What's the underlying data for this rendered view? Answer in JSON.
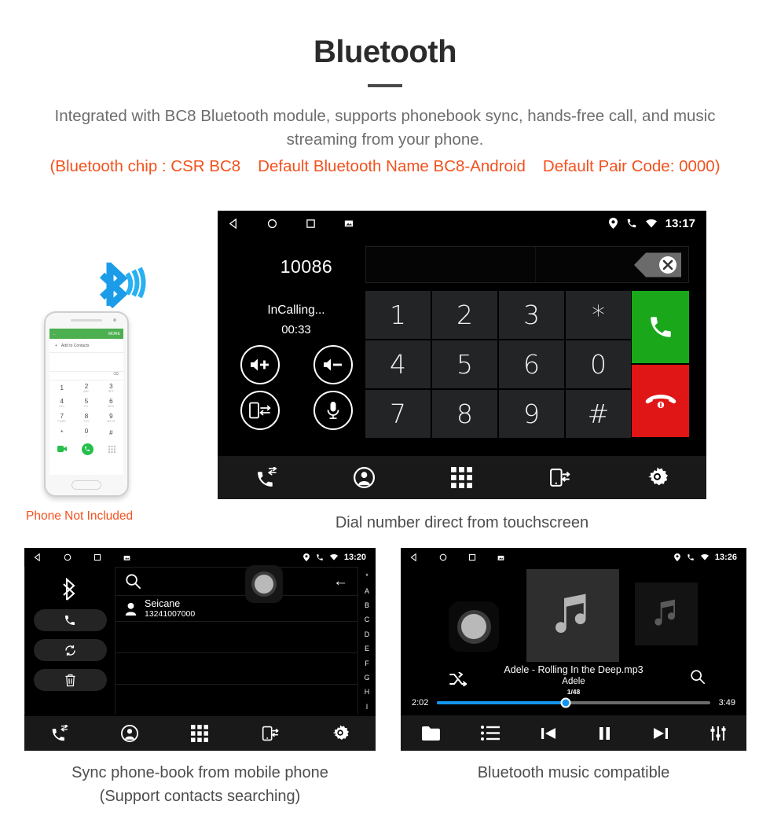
{
  "header": {
    "title": "Bluetooth",
    "intro": "Integrated with BC8 Bluetooth module, supports phonebook sync, hands-free call, and music streaming from your phone.",
    "spec_part1": "(Bluetooth chip : CSR BC8",
    "spec_part2": "Default Bluetooth Name BC8-Android",
    "spec_part3": "Default Pair Code: 0000)",
    "accent_color": "#f4511e",
    "body_color": "#6d6d6d"
  },
  "phone_mock": {
    "caption": "Phone Not Included",
    "appbar_back": "←",
    "appbar_more": "MORE",
    "add_contact": "Add to Contacts",
    "keys": [
      {
        "digit": "1",
        "sub": ""
      },
      {
        "digit": "2",
        "sub": "ABC"
      },
      {
        "digit": "3",
        "sub": "DEF"
      },
      {
        "digit": "4",
        "sub": "GHI"
      },
      {
        "digit": "5",
        "sub": "JKL"
      },
      {
        "digit": "6",
        "sub": "MNO"
      },
      {
        "digit": "7",
        "sub": "PQRS"
      },
      {
        "digit": "8",
        "sub": "TUV"
      },
      {
        "digit": "9",
        "sub": "WXYZ"
      },
      {
        "digit": "*",
        "sub": ""
      },
      {
        "digit": "0",
        "sub": "+"
      },
      {
        "digit": "#",
        "sub": ""
      }
    ]
  },
  "dialer": {
    "status": {
      "time": "13:17",
      "icons_left": [
        "back-icon",
        "home-icon",
        "recents-icon",
        "screenshot-icon"
      ],
      "icons_right": [
        "location-icon",
        "phone-icon",
        "wifi-icon"
      ]
    },
    "number": "10086",
    "call_status": "InCalling...",
    "call_timer": "00:33",
    "controls": [
      "volume-up-icon",
      "volume-down-icon",
      "audio-transfer-icon",
      "mute-mic-icon"
    ],
    "keys": [
      "1",
      "2",
      "3",
      "*",
      "4",
      "5",
      "6",
      "0",
      "7",
      "8",
      "9",
      "#"
    ],
    "call_button": "answer-call-icon",
    "hangup_button": "end-call-icon",
    "call_color": "#1aa81a",
    "hangup_color": "#e01515",
    "navbar": [
      "call-log-icon",
      "contacts-icon",
      "keypad-icon",
      "audio-transfer-icon",
      "settings-icon"
    ],
    "caption": "Dial number direct from touchscreen"
  },
  "phonebook": {
    "status": {
      "time": "13:20",
      "icons_right": [
        "location-icon",
        "phone-icon",
        "wifi-icon"
      ]
    },
    "side_icons": [
      "bluetooth-icon",
      "phone-icon",
      "sync-icon",
      "delete-icon"
    ],
    "search_placeholder": "",
    "back_arrow": "←",
    "contacts": [
      {
        "name": "Seicane",
        "number": "13241007000"
      }
    ],
    "alphabet": [
      "*",
      "A",
      "B",
      "C",
      "D",
      "E",
      "F",
      "G",
      "H",
      "I"
    ],
    "navbar": [
      "call-log-icon",
      "contacts-icon",
      "keypad-icon",
      "audio-transfer-icon",
      "settings-icon"
    ],
    "caption_line1": "Sync phone-book from mobile phone",
    "caption_line2": "(Support contacts searching)"
  },
  "music": {
    "status": {
      "time": "13:26",
      "icons_right": [
        "location-icon",
        "phone-icon",
        "wifi-icon"
      ]
    },
    "track_title": "Adele - Rolling In the Deep.mp3",
    "artist": "Adele",
    "track_count": "1/48",
    "elapsed": "2:02",
    "duration": "3:49",
    "progress_percent": 47,
    "progress_color": "#1296f0",
    "transport": [
      "folder-icon",
      "playlist-icon",
      "previous-icon",
      "pause-icon",
      "next-icon",
      "equalizer-icon"
    ],
    "caption": "Bluetooth music compatible"
  }
}
